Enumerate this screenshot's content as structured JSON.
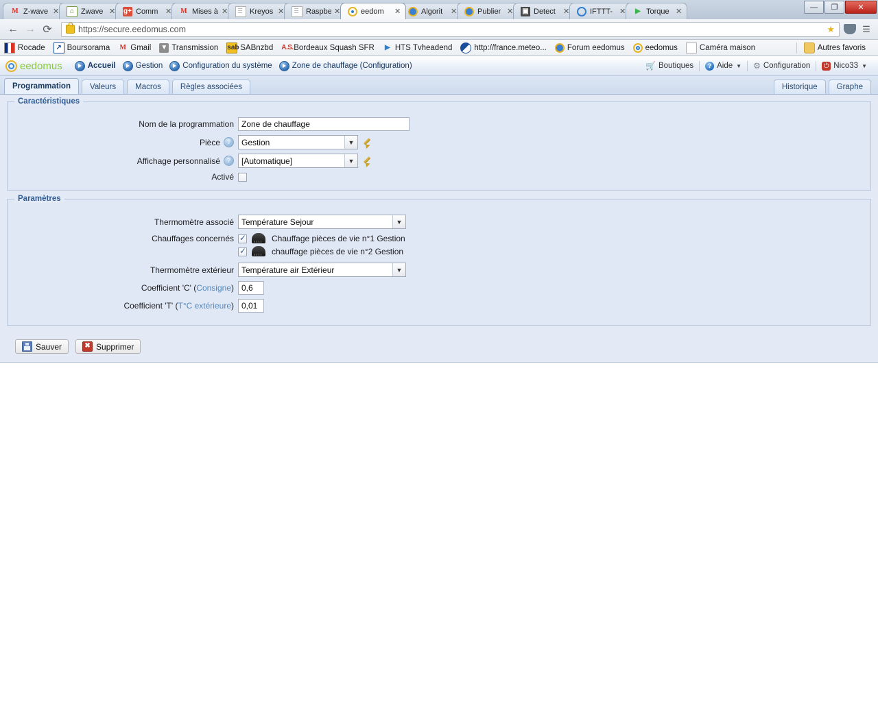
{
  "browser": {
    "tabs": [
      {
        "label": "Z-wave",
        "icon": "gmail-icon",
        "active": false
      },
      {
        "label": "Zwave",
        "icon": "zwave-icon",
        "active": false
      },
      {
        "label": "Comm",
        "icon": "google-plus-icon",
        "active": false
      },
      {
        "label": "Mises à",
        "icon": "gmail-icon",
        "active": false
      },
      {
        "label": "Kreyos",
        "icon": "document-icon",
        "active": false
      },
      {
        "label": "Raspbe",
        "icon": "document-icon",
        "active": false
      },
      {
        "label": "eedom",
        "icon": "eedomus-icon",
        "active": true
      },
      {
        "label": "Algorit",
        "icon": "algorithm-icon",
        "active": false
      },
      {
        "label": "Publier",
        "icon": "algorithm-icon",
        "active": false
      },
      {
        "label": "Detect",
        "icon": "detection-icon",
        "active": false
      },
      {
        "label": "IFTTT-",
        "icon": "ifttt-icon",
        "active": false
      },
      {
        "label": "Torque",
        "icon": "play-store-icon",
        "active": false
      }
    ],
    "close_label": "✕",
    "window_controls": {
      "minimize": "—",
      "maximize": "❐",
      "close": "✕"
    },
    "nav": {
      "back": "←",
      "forward": "→",
      "reload": "⟳",
      "star": "★",
      "menu": "☰"
    },
    "url": {
      "scheme": "https://",
      "host": "secure.eedomus.com",
      "full": "https://secure.eedomus.com"
    },
    "bookmarks": [
      {
        "label": "Rocade",
        "icon": "france-flag-icon"
      },
      {
        "label": "Boursorama",
        "icon": "boursorama-icon"
      },
      {
        "label": "Gmail",
        "icon": "gmail-icon"
      },
      {
        "label": "Transmission",
        "icon": "transmission-icon"
      },
      {
        "label": "SABnzbd",
        "icon": "sabnzbd-icon"
      },
      {
        "label": "Bordeaux Squash SFR",
        "icon": "as-groupe-icon"
      },
      {
        "label": "HTS Tvheadend",
        "icon": "hts-icon"
      },
      {
        "label": "http://france.meteo...",
        "icon": "meteo-icon"
      },
      {
        "label": "Forum eedomus",
        "icon": "forum-icon"
      },
      {
        "label": "eedomus",
        "icon": "eedomus-icon"
      },
      {
        "label": "Caméra maison",
        "icon": "page-icon"
      }
    ],
    "other_bookmarks": {
      "label": "Autres favoris",
      "icon": "folder-icon"
    }
  },
  "app": {
    "logo": "eedomus",
    "breadcrumbs": [
      {
        "label": "Accueil",
        "bold": true
      },
      {
        "label": "Gestion",
        "bold": false
      },
      {
        "label": "Configuration du système",
        "bold": false
      },
      {
        "label": "Zone de chauffage (Configuration)",
        "bold": false
      }
    ],
    "header_right": [
      {
        "label": "Boutiques",
        "icon": "cart-icon",
        "caret": false
      },
      {
        "label": "Aide",
        "icon": "help-icon",
        "caret": true
      },
      {
        "label": "Configuration",
        "icon": "gear-icon",
        "caret": false
      },
      {
        "label": "Nico33",
        "icon": "power-icon",
        "caret": true
      }
    ],
    "tabs": [
      {
        "label": "Programmation",
        "active": true
      },
      {
        "label": "Valeurs",
        "active": false
      },
      {
        "label": "Macros",
        "active": false
      },
      {
        "label": "Règles associées",
        "active": false
      }
    ],
    "tabs_right": [
      {
        "label": "Historique"
      },
      {
        "label": "Graphe"
      }
    ]
  },
  "caracteristiques": {
    "title": "Caractéristiques",
    "nom_label": "Nom de la programmation",
    "nom_value": "Zone de chauffage",
    "piece_label": "Pièce",
    "piece_value": "Gestion",
    "affichage_label": "Affichage personnalisé",
    "affichage_value": "[Automatique]",
    "active_label": "Activé",
    "active_checked": false,
    "help_glyph": "?"
  },
  "parametres": {
    "title": "Paramètres",
    "thermo_label": "Thermomètre associé",
    "thermo_value": "Température Sejour",
    "chauffages_label": "Chauffages concernés",
    "chauffages": [
      {
        "label": "Chauffage pièces de vie n°1 Gestion",
        "checked": true
      },
      {
        "label": "chauffage pièces de vie n°2 Gestion",
        "checked": true
      }
    ],
    "thermo_ext_label": "Thermomètre extérieur",
    "thermo_ext_value": "Température air Extérieur",
    "coef_c_label": "Coefficient 'C' (",
    "coef_c_sub": "Consigne",
    "coef_c_label_end": ")",
    "coef_c_value": "0,6",
    "coef_t_label": "Coefficient 'T' (",
    "coef_t_sub": "T°C extérieure",
    "coef_t_label_end": ")",
    "coef_t_value": "0,01"
  },
  "actions": {
    "save_label": "Sauver",
    "delete_label": "Supprimer",
    "delete_glyph": "✖"
  }
}
